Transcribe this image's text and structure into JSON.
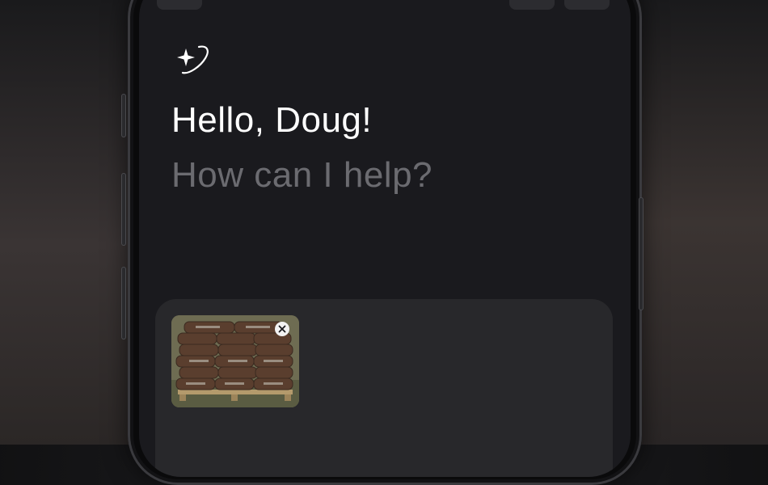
{
  "assistant": {
    "icon": "sparkle-orbit-icon",
    "greeting": "Hello, Doug!",
    "prompt": "How can I help?"
  },
  "composer": {
    "attachment": {
      "kind": "image",
      "description_icon": "mulch-bags-on-pallet-photo",
      "remove_icon": "close-icon"
    }
  },
  "colors": {
    "screen_bg": "#1a1a1e",
    "greeting_text": "#ffffff",
    "prompt_text": "#6b6b70",
    "panel_bg": "#28282b"
  }
}
